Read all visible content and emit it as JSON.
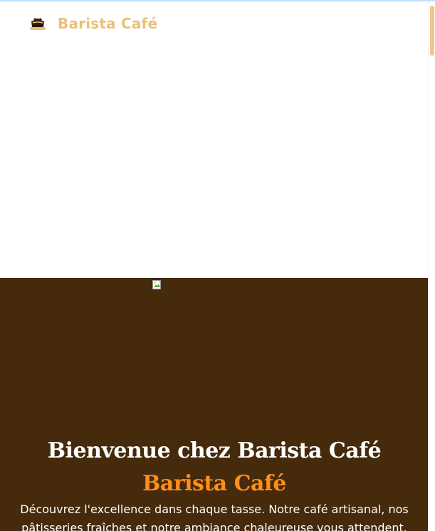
{
  "header": {
    "brand_name": "Barista Café",
    "logo_icon": "coffee-cup-icon"
  },
  "hero": {
    "image_icon": "broken-image-icon",
    "title": "Bienvenue chez Barista Café",
    "subtitle": "Barista Café",
    "description": "Découvrez l'excellence dans chaque tasse. Notre café artisanal, nos pâtisseries fraîches et notre ambiance chaleureuse vous attendent."
  },
  "colors": {
    "brand": "#eac177",
    "hero_background": "#452a0b",
    "accent": "#ff8f1a"
  }
}
